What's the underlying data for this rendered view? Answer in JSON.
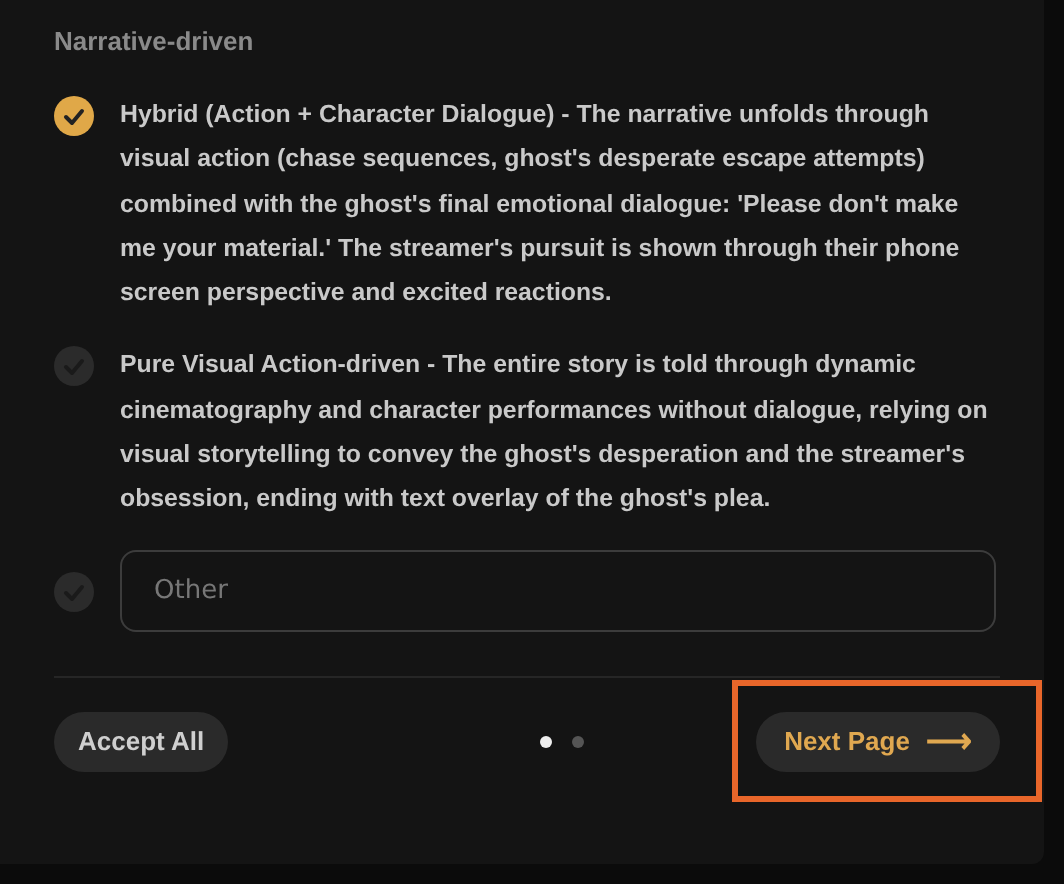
{
  "section_title": "Narrative-driven",
  "options": [
    {
      "kind": "choice",
      "selected": true,
      "text": "Hybrid (Action + Character Dialogue) - The narrative unfolds through visual action (chase sequences, ghost's desperate escape attempts) combined with the ghost's final emotional dialogue: 'Please don't make me your material.' The streamer's pursuit is shown through their phone screen perspective and excited reactions."
    },
    {
      "kind": "choice",
      "selected": false,
      "text": "Pure Visual Action-driven - The entire story is told through dynamic cinematography and character performances without dialogue, relying on visual storytelling to convey the ghost's desperation and the streamer's obsession, ending with text overlay of the ghost's plea."
    },
    {
      "kind": "input",
      "selected": false,
      "placeholder": "Other"
    }
  ],
  "footer": {
    "accept_button": "Accept All",
    "pages": [
      {
        "selected": true
      },
      {
        "selected": false
      }
    ],
    "next_button": "Next Page",
    "next_arrow": "⟶",
    "highlighted": true
  }
}
